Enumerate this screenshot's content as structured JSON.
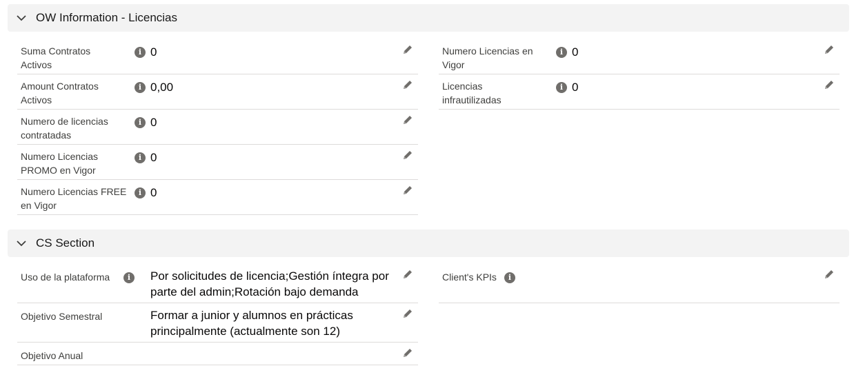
{
  "sections": [
    {
      "title": "OW Information - Licencias",
      "left_fields": [
        {
          "label_line1": "Suma Contratos",
          "label_line2": "Activos",
          "value": "0"
        },
        {
          "label_line1": "Amount Contratos",
          "label_line2": "Activos",
          "value": "0,00"
        },
        {
          "label_line1": "Numero de licencias",
          "label_line2": "contratadas",
          "value": "0"
        },
        {
          "label_line1": "Numero Licencias",
          "label_line2": "PROMO en Vigor",
          "value": "0"
        },
        {
          "label_line1": "Numero Licencias FREE",
          "label_line2": "en Vigor",
          "value": "0"
        }
      ],
      "right_fields": [
        {
          "label_line1": "Numero Licencias en",
          "label_line2": "Vigor",
          "value": "0"
        },
        {
          "label_line1": "Licencias",
          "label_line2": "infrautilizadas",
          "value": "0"
        }
      ]
    },
    {
      "title": "CS Section",
      "left_fields": [
        {
          "label": "Uso de la plataforma",
          "value_line1": "Por solicitudes de licencia;Gestión íntegra por",
          "value_line2": "parte del admin;Rotación bajo demanda"
        },
        {
          "label": "Objetivo Semestral",
          "value_line1": "Formar a junior y alumnos en prácticas",
          "value_line2": "principalmente (actualmente son 12)"
        },
        {
          "label": "Objetivo Anual",
          "value_line1": "",
          "value_line2": ""
        }
      ],
      "right_fields": [
        {
          "label": "Client's KPIs",
          "value": ""
        }
      ]
    }
  ],
  "icons": {
    "info": "i",
    "edit": "pencil-icon",
    "collapse": "chevron-down-icon"
  },
  "colors": {
    "header_bg": "#f3f3f3",
    "divider": "#dddbda",
    "icon_gray": "#706e6b"
  }
}
